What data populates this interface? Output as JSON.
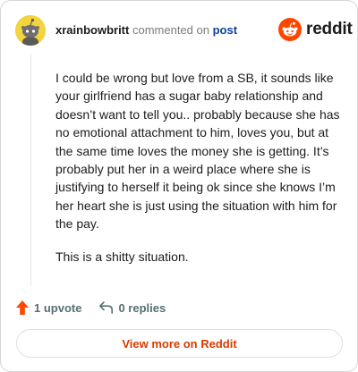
{
  "header": {
    "username": "xrainbowbritt",
    "action_text": "commented on",
    "post_link": "post",
    "logo_text": "reddit"
  },
  "comment": {
    "paragraphs": [
      "I could be wrong but love from a SB, it sounds like your girlfriend has a sugar baby relationship and doesn’t want to tell you.. probably because she has no emotional attachment to him, loves you, but at the same time loves the money she is getting. It’s probably put her in a weird place where she is justifying to herself it being ok since she knows I’m her heart she is just using the situation with him for the pay.",
      "This is a shitty situation."
    ]
  },
  "actions": {
    "upvotes": "1 upvote",
    "replies": "0 replies"
  },
  "footer": {
    "view_more_label": "View more on Reddit"
  },
  "colors": {
    "brand": "#ff4500",
    "link": "#0a449b",
    "view_more": "#d93a00",
    "avatar_bg": "#f2d43f"
  },
  "icons": [
    "snoo-avatar-icon",
    "reddit-logo-icon",
    "upvote-arrow-icon",
    "reply-arrow-icon"
  ]
}
